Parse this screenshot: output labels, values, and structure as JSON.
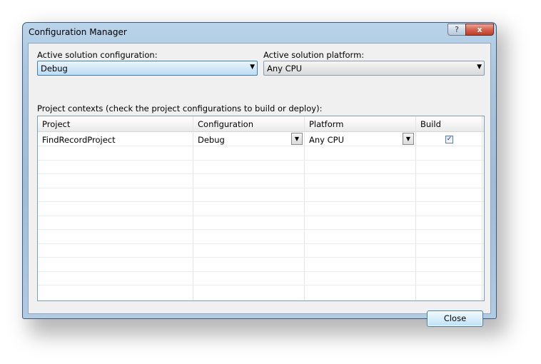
{
  "window": {
    "title": "Configuration Manager",
    "help_glyph": "?",
    "close_glyph": "x"
  },
  "active_config": {
    "label": "Active solution configuration:",
    "value": "Debug"
  },
  "active_platform": {
    "label": "Active solution platform:",
    "value": "Any CPU"
  },
  "contexts": {
    "label": "Project contexts (check the project configurations to build or deploy):",
    "columns": [
      "Project",
      "Configuration",
      "Platform",
      "Build"
    ],
    "rows": [
      {
        "project": "FindRecordProject",
        "configuration": "Debug",
        "platform": "Any CPU",
        "build": true
      }
    ]
  },
  "buttons": {
    "close_label": "Close"
  },
  "icons": {
    "dropdown": "chevron-down-icon",
    "check": "checkmark-icon"
  },
  "colors": {
    "accent": "#3c7fb1",
    "frame": "#a9c6df",
    "close_red": "#c23d24"
  }
}
